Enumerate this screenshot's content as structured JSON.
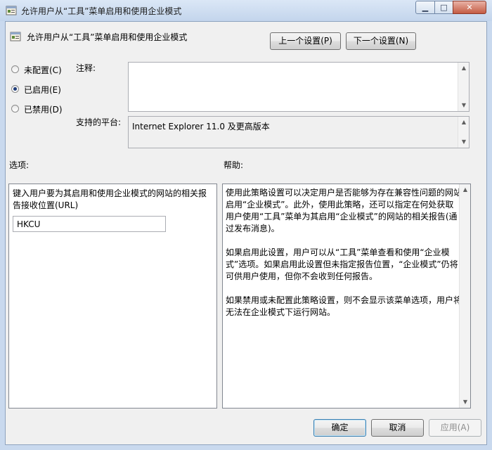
{
  "window": {
    "title": "允许用户从“工具”菜单启用和使用企业模式",
    "minimize_glyph": "▁",
    "maximize_glyph": "□",
    "close_glyph": "✕"
  },
  "header": {
    "policy_title": "允许用户从“工具”菜单启用和使用企业模式",
    "prev_setting_label": "上一个设置(P)",
    "next_setting_label": "下一个设置(N)"
  },
  "state": {
    "options": [
      {
        "label": "未配置(C)",
        "selected": false
      },
      {
        "label": "已启用(E)",
        "selected": true
      },
      {
        "label": "已禁用(D)",
        "selected": false
      }
    ]
  },
  "comment": {
    "label": "注释:",
    "value": ""
  },
  "platform": {
    "label": "支持的平台:",
    "value": "Internet Explorer 11.0 及更高版本"
  },
  "options_section": {
    "label": "选项:",
    "description": "键入用户要为其启用和使用企业模式的网站的相关报告接收位置(URL)",
    "input_value": "HKCU"
  },
  "help_section": {
    "label": "帮助:",
    "paragraphs": [
      "使用此策略设置可以决定用户是否能够为存在兼容性问题的网站启用“企业模式”。此外，使用此策略，还可以指定在何处获取用户使用“工具”菜单为其启用“企业模式”的网站的相关报告(通过发布消息)。",
      "如果启用此设置，用户可以从“工具”菜单查看和使用“企业模式”选项。如果启用此设置但未指定报告位置，“企业模式”仍将可供用户使用，但你不会收到任何报告。",
      "如果禁用或未配置此策略设置，则不会显示该菜单选项，用户将无法在企业模式下运行网站。"
    ]
  },
  "footer": {
    "ok_label": "确定",
    "cancel_label": "取消",
    "apply_label": "应用(A)"
  },
  "scroll": {
    "up_glyph": "▲",
    "down_glyph": "▼"
  }
}
